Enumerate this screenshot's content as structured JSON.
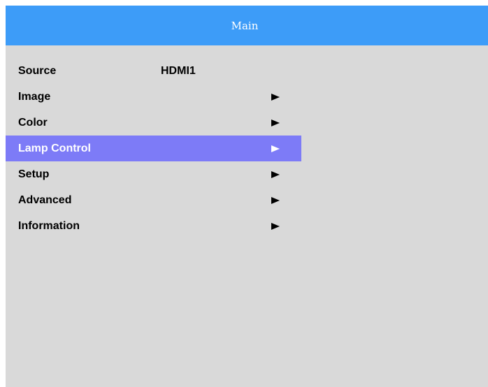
{
  "header": {
    "title": "Main"
  },
  "colors": {
    "header_bg": "#3d9cf8",
    "panel_bg": "#d9d9d9",
    "selected_bg": "#7d7bf7"
  },
  "menu": {
    "selected": "Lamp Control",
    "items": [
      {
        "label": "Source",
        "value": "HDMI1",
        "submenu": false
      },
      {
        "label": "Image",
        "submenu": true,
        "icon": "play-arrow-icon"
      },
      {
        "label": "Color",
        "submenu": true,
        "icon": "play-arrow-icon"
      },
      {
        "label": "Lamp Control",
        "submenu": true,
        "icon": "play-arrow-icon"
      },
      {
        "label": "Setup",
        "submenu": true,
        "icon": "play-arrow-icon"
      },
      {
        "label": "Advanced",
        "submenu": true,
        "icon": "play-arrow-icon"
      },
      {
        "label": "Information",
        "submenu": true,
        "icon": "play-arrow-icon"
      }
    ]
  }
}
